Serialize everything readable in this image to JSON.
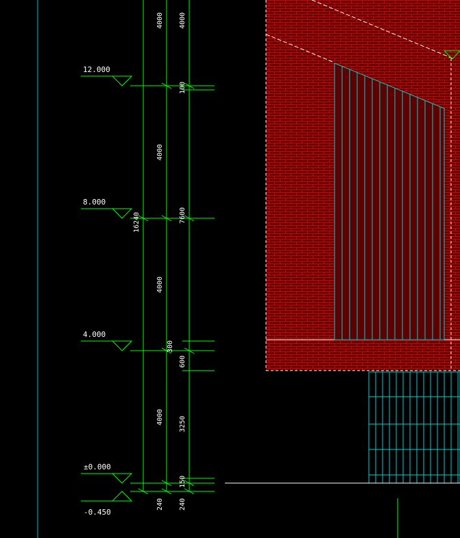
{
  "colors": {
    "background": "#000000",
    "dimension_lines": "#00ff00",
    "grid_line": "#00c8c8",
    "glazing": "#00d0d0",
    "brick_fill": "#6a0000",
    "brick_mortar": "#b00000",
    "outline": "#ffffff",
    "text": "#ffffff"
  },
  "elevations": {
    "level_12": "12.000",
    "level_8": "8.000",
    "level_4": "4.000",
    "level_0": "±0.000",
    "level_ground": "-0.450"
  },
  "dimensions": {
    "inner_top": "4000",
    "inner_third": "4000",
    "inner_second": "4000",
    "inner_first": "4000",
    "inner_base": "240",
    "overall": "16240",
    "outer_top": "4000",
    "outer_100": "100",
    "outer_7600": "7600",
    "outer_300": "300",
    "outer_600": "600",
    "outer_3250": "3250",
    "outer_150": "150",
    "outer_base": "240"
  },
  "icons": {
    "level_marker": "elevation-triangle-icon",
    "ground_marker": "ground-level-triangle-icon"
  }
}
